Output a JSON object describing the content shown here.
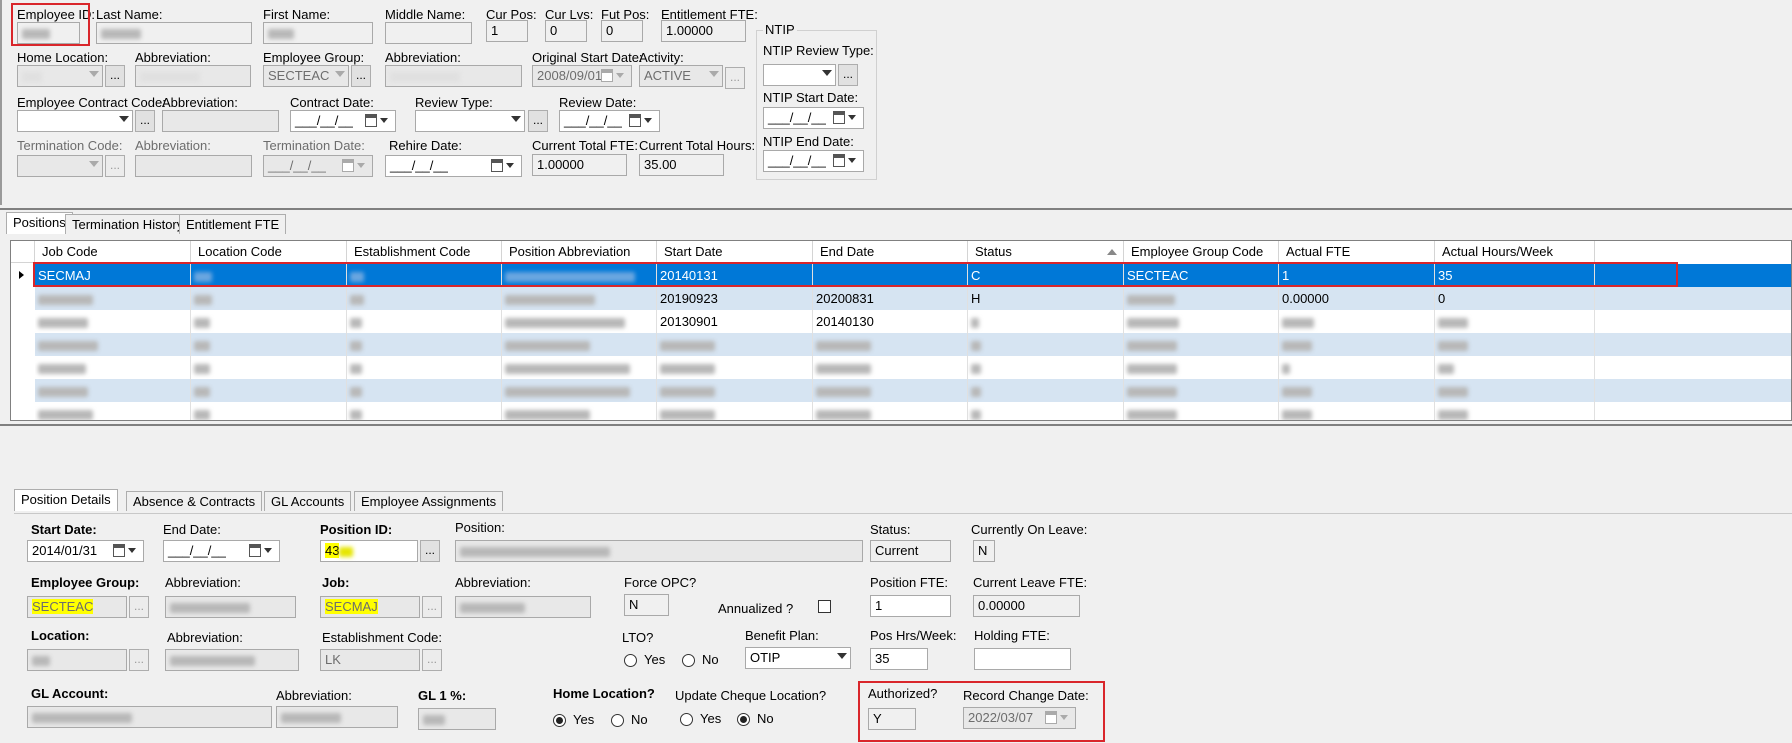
{
  "header": {
    "employee_id_label": "Employee ID:",
    "last_name_label": "Last Name:",
    "first_name_label": "First Name:",
    "middle_name_label": "Middle Name:",
    "cur_pos_label": "Cur Pos:",
    "cur_pos_value": "1",
    "cur_lvs_label": "Cur Lvs:",
    "cur_lvs_value": "0",
    "fut_pos_label": "Fut Pos:",
    "fut_pos_value": "0",
    "entitlement_fte_label": "Entitlement FTE:",
    "entitlement_fte_value": "1.00000",
    "home_location_label": "Home Location:",
    "abbreviation_label": "Abbreviation:",
    "employee_group_label": "Employee Group:",
    "employee_group_value": "SECTEAC",
    "original_start_date_label": "Original Start Date:",
    "original_start_date_value": "2008/09/01",
    "activity_label": "Activity:",
    "activity_value": "ACTIVE",
    "employee_contract_code_label": "Employee Contract Code:",
    "contract_date_label": "Contract Date:",
    "review_type_label": "Review Type:",
    "review_date_label": "Review Date:",
    "termination_code_label": "Termination Code:",
    "termination_date_label": "Termination Date:",
    "rehire_date_label": "Rehire Date:",
    "current_total_fte_label": "Current Total FTE:",
    "current_total_fte_value": "1.00000",
    "current_total_hours_label": "Current Total Hours:",
    "current_total_hours_value": "35.00",
    "empty_date": "___/__/__",
    "ellipsis": "..."
  },
  "ntip": {
    "group_label": "NTIP",
    "review_type_label": "NTIP Review Type:",
    "start_date_label": "NTIP Start Date:",
    "end_date_label": "NTIP End Date:"
  },
  "top_tabs": [
    "Positions",
    "Termination History",
    "Entitlement FTE"
  ],
  "grid": {
    "columns": [
      "Job Code",
      "Location Code",
      "Establishment Code",
      "Position Abbreviation",
      "Start Date",
      "End Date",
      "Status",
      "Employee Group Code",
      "Actual FTE",
      "Actual Hours/Week"
    ],
    "rows": [
      {
        "job_code": "SECMAJ",
        "start_date": "20140131",
        "end_date": "",
        "status": "C",
        "group": "SECTEAC",
        "fte": "1",
        "hours": "35"
      },
      {
        "job_code": "",
        "start_date": "20190923",
        "end_date": "20200831",
        "status": "H",
        "group": "",
        "fte": "0.00000",
        "hours": "0"
      },
      {
        "job_code": "",
        "start_date": "20130901",
        "end_date": "20140130",
        "status": "",
        "group": "",
        "fte": "",
        "hours": ""
      }
    ]
  },
  "bottom_tabs": [
    "Position Details",
    "Absence & Contracts",
    "GL Accounts",
    "Employee Assignments"
  ],
  "details": {
    "start_date_label": "Start Date:",
    "start_date_value": "2014/01/31",
    "end_date_label": "End Date:",
    "position_id_label": "Position ID:",
    "position_id_value": "43",
    "position_label": "Position:",
    "status_label": "Status:",
    "status_value": "Current",
    "currently_on_leave_label": "Currently On Leave:",
    "currently_on_leave_value": "N",
    "employee_group_label": "Employee Group:",
    "employee_group_value": "SECTEAC",
    "abbreviation_label": "Abbreviation:",
    "job_label": "Job:",
    "job_value": "SECMAJ",
    "force_opc_label": "Force OPC?",
    "force_opc_value": "N",
    "annualized_label": "Annualized ?",
    "position_fte_label": "Position FTE:",
    "position_fte_value": "1",
    "current_leave_fte_label": "Current Leave FTE:",
    "current_leave_fte_value": "0.00000",
    "location_label": "Location:",
    "establishment_code_label": "Establishment Code:",
    "establishment_code_value": "LK",
    "lto_label": "LTO?",
    "yes_label": "Yes",
    "no_label": "No",
    "benefit_plan_label": "Benefit Plan:",
    "benefit_plan_value": "OTIP",
    "pos_hrs_week_label": "Pos Hrs/Week:",
    "pos_hrs_week_value": "35",
    "holding_fte_label": "Holding FTE:",
    "gl_account_label": "GL Account:",
    "gl1_label": "GL 1 %:",
    "home_location_label": "Home Location?",
    "update_cheque_location_label": "Update Cheque Location?",
    "authorized_label": "Authorized?",
    "authorized_value": "Y",
    "record_change_date_label": "Record Change Date:",
    "record_change_date_value": "2022/03/07"
  }
}
